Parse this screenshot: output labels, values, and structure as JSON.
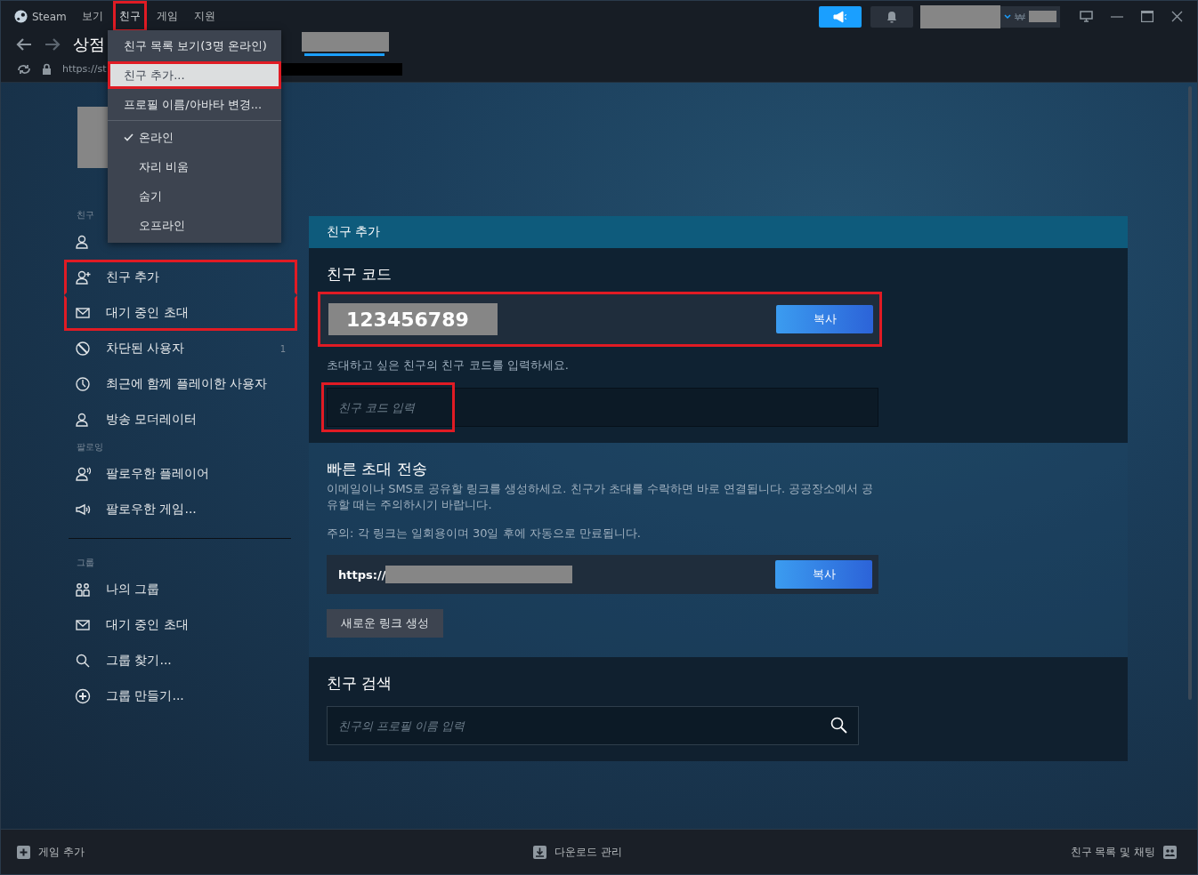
{
  "menubar": {
    "brand": "Steam",
    "items": [
      {
        "label": "보기",
        "highlighted": false
      },
      {
        "label": "친구",
        "highlighted": true
      },
      {
        "label": "게임",
        "highlighted": false
      },
      {
        "label": "지원",
        "highlighted": false
      }
    ]
  },
  "nav": {
    "title": "상점",
    "url": "https://st"
  },
  "menu": {
    "items": [
      {
        "kind": "action",
        "label": "친구 목록 보기(3명 온라인)",
        "highlighted": false,
        "hovered": false
      },
      {
        "kind": "action",
        "label": "친구 추가...",
        "highlighted": true,
        "hovered": true
      },
      {
        "kind": "action",
        "label": "프로필 이름/아바타 변경...",
        "highlighted": false,
        "hovered": false
      },
      {
        "kind": "separator"
      },
      {
        "kind": "status",
        "label": "온라인",
        "checked": true
      },
      {
        "kind": "status",
        "label": "자리 비움",
        "checked": false
      },
      {
        "kind": "status",
        "label": "숨기",
        "checked": false
      },
      {
        "kind": "status",
        "label": "오프라인",
        "checked": false
      }
    ]
  },
  "sidebar": {
    "sections": [
      {
        "heading": "친구",
        "items": [
          {
            "highlighted": false
          },
          {
            "label": "친구 추가",
            "highlighted": true
          },
          {
            "label": "대기 중인 초대",
            "highlighted": true
          },
          {
            "label": "차단된 사용자",
            "count": "1",
            "highlighted": false
          },
          {
            "label": "최근에 함께 플레이한 사용자",
            "highlighted": false
          },
          {
            "label": "방송 모더레이터",
            "highlighted": false
          }
        ]
      },
      {
        "heading": "팔로잉",
        "items": [
          {
            "label": "팔로우한 플레이어",
            "highlighted": false
          },
          {
            "label": "팔로우한 게임...",
            "highlighted": false
          }
        ]
      },
      {
        "heading": "그룹",
        "divider_before": true,
        "items": [
          {
            "label": "나의 그룹",
            "highlighted": false
          },
          {
            "label": "대기 중인 초대",
            "highlighted": false
          },
          {
            "label": "그룹 찾기...",
            "highlighted": false
          },
          {
            "label": "그룹 만들기...",
            "highlighted": false
          }
        ]
      }
    ]
  },
  "panel": {
    "header": "친구 추가",
    "friend_code": {
      "title": "친구 코드",
      "code": "123456789",
      "copy_button": "복사",
      "highlighted": true,
      "hint": "초대하고 싶은 친구의 친구 코드를 입력하세요.",
      "input": {
        "placeholder": "친구 코드 입력",
        "highlighted": true
      }
    },
    "quick_invite": {
      "title": "빠른 초대 전송",
      "description": "이메일이나 SMS로 공유할 링크를 생성하세요. 친구가 초대를 수락하면 바로 연결됩니다. 공공장소에서 공유할 때는 주의하시기 바랍니다.",
      "note": "주의: 각 링크는 일회용이며 30일 후에 자동으로 만료됩니다.",
      "link": "https://",
      "copy_button": "복사",
      "new_link_button": "새로운 링크 생성"
    },
    "search": {
      "title": "친구 검색",
      "placeholder": "친구의 프로필 이름 입력"
    }
  },
  "bottom_bar": {
    "add_game": "게임 추가",
    "downloads": "다운로드 관리",
    "friends_chat": "친구 목록 및 채팅"
  }
}
